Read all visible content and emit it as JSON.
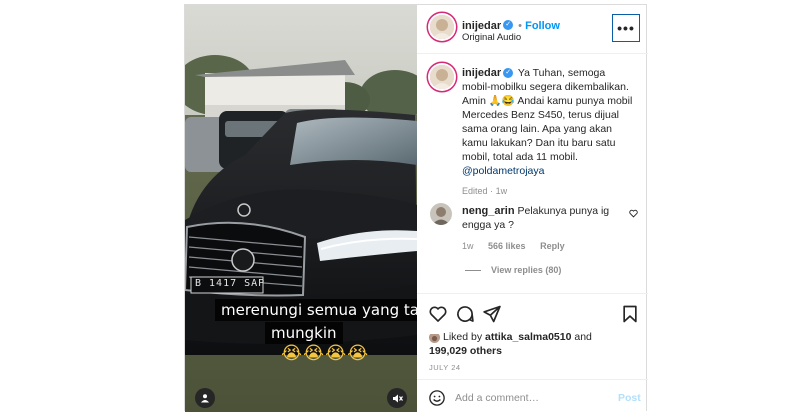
{
  "header": {
    "username": "inijedar",
    "follow_label": "Follow",
    "subtitle": "Original Audio",
    "more_label": "•••"
  },
  "media": {
    "caption_lines": [
      "merenungi semua yang tak",
      "mungkin"
    ],
    "emojis": "😭😭😭😭",
    "plate_text": "B 1417 SAP"
  },
  "caption": {
    "username": "inijedar",
    "text": "Ya Tuhan, semoga mobil-mobilku segera dikembalikan. Amin 🙏😂 Andai kamu punya mobil Mercedes Benz S450, terus dijual sama orang lain. Apa yang akan kamu lakukan? Dan itu baru satu mobil, total ada 11 mobil.",
    "mention": "@poldametrojaya",
    "edited": "Edited",
    "separator": "·",
    "age": "1w"
  },
  "comment": {
    "username": "neng_arin",
    "text": "Pelakunya punya ig engga ya ?",
    "age": "1w",
    "likes": "566 likes",
    "reply_label": "Reply",
    "view_replies": "View replies (80)"
  },
  "likes": {
    "prefix": "Liked by",
    "liker": "attika_salma0510",
    "and": "and",
    "others": "199,029 others"
  },
  "date": "JULY 24",
  "add_comment": {
    "placeholder": "Add a comment…",
    "post_label": "Post"
  },
  "colors": {
    "accent": "#0095f6",
    "verified": "#3897f0",
    "muted": "#8e8e8e"
  }
}
